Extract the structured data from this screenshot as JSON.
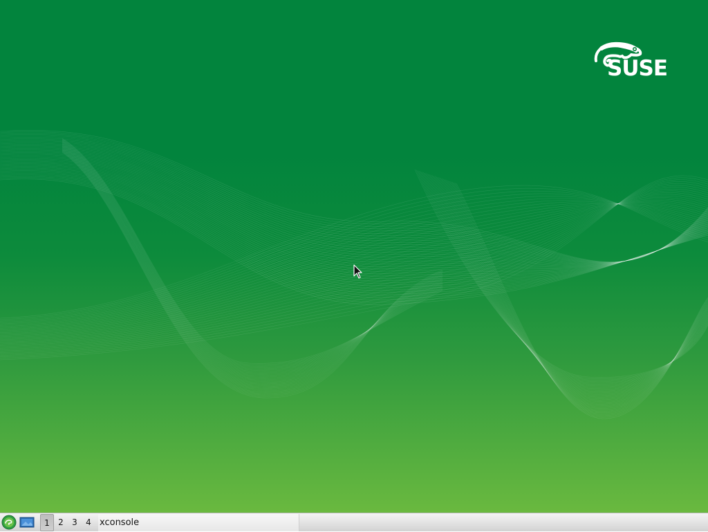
{
  "desktop": {
    "logo_text": "SUSE",
    "background_top": "#02843d",
    "background_bottom": "#6ab93f"
  },
  "taskbar": {
    "menu_icon": "suse-chameleon-icon",
    "show_desktop_icon": "desktop-icon",
    "workspaces": [
      "1",
      "2",
      "3",
      "4"
    ],
    "active_workspace": "1",
    "tasks": [
      {
        "title": "xconsole"
      }
    ]
  }
}
